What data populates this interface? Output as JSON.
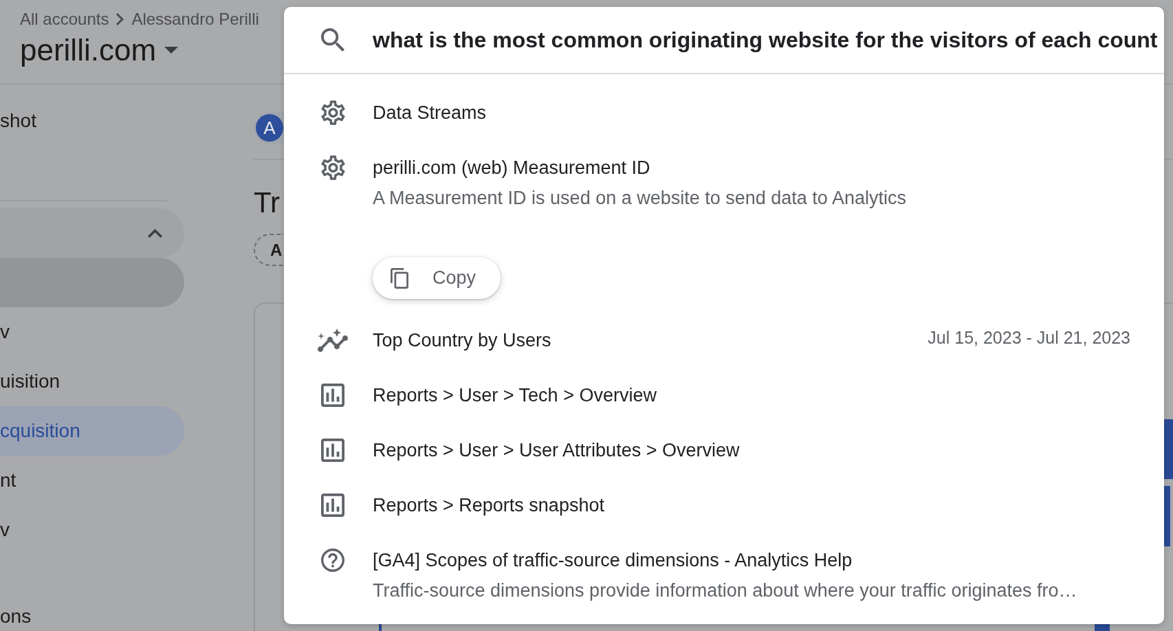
{
  "header": {
    "breadcrumb": [
      "All accounts",
      "Alessandro Perilli"
    ],
    "property": "perilli.com"
  },
  "sidebar": {
    "items": [
      {
        "kind": "item",
        "label": "shot",
        "selected": false,
        "highlighted": false
      },
      {
        "kind": "divider"
      },
      {
        "kind": "group",
        "expanded": true,
        "selected": false
      },
      {
        "kind": "item",
        "selected": false,
        "highlighted": true
      },
      {
        "kind": "item",
        "label": "v",
        "selected": false,
        "highlighted": false
      },
      {
        "kind": "item",
        "label": "uisition",
        "selected": false,
        "highlighted": false
      },
      {
        "kind": "item",
        "label": "cquisition",
        "selected": true,
        "highlighted": false
      },
      {
        "kind": "item",
        "label": "nt",
        "selected": false,
        "highlighted": false
      },
      {
        "kind": "item",
        "label": "v",
        "selected": false,
        "highlighted": false
      },
      {
        "kind": "section",
        "label": "ons"
      }
    ]
  },
  "main": {
    "avatar": {
      "initial": "A"
    },
    "title": "Tr",
    "chip": "A"
  },
  "search_dialog": {
    "search": {
      "value": "what is the most common originating website for the visitors of each count"
    },
    "results": [
      {
        "kind": "setting",
        "title": "Data Streams"
      },
      {
        "kind": "setting",
        "title": "perilli.com (web) Measurement ID",
        "description": "A Measurement ID is used on a website to send data to Analytics",
        "action": "Copy"
      },
      {
        "kind": "insight",
        "title": "Top Country by Users",
        "date": "Jul 15, 2023 - Jul 21, 2023"
      },
      {
        "kind": "report",
        "title": "Reports > User > Tech > Overview"
      },
      {
        "kind": "report",
        "title": "Reports > User > User Attributes > Overview"
      },
      {
        "kind": "report",
        "title": "Reports > Reports snapshot"
      },
      {
        "kind": "help",
        "title": "[GA4] Scopes of traffic-source dimensions - Analytics Help",
        "description": "Traffic-source dimensions provide information about where your traffic originates fro…"
      }
    ]
  }
}
